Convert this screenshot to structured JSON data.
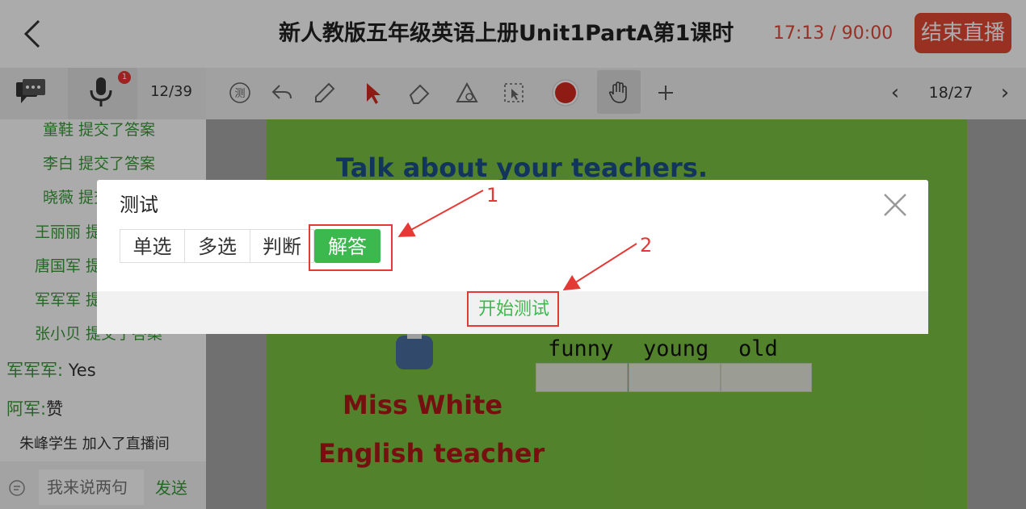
{
  "header": {
    "back_glyph": "〈",
    "title": "新人教版五年级英语上册Unit1PartA第1课时",
    "timer": "17:13 / 90:00",
    "end_button": "结束直播"
  },
  "toolbar": {
    "mic_badge": "1",
    "attendance": "12/39",
    "tool_icons": [
      "quiz-icon",
      "undo-icon",
      "pen-icon",
      "pointer-icon",
      "eraser-icon",
      "shapes-icon",
      "selection-icon",
      "color-dot-icon",
      "hand-icon",
      "plus-icon"
    ],
    "page_prev": "‹",
    "page_count": "18/27",
    "page_next": "›",
    "color": "#d62b1f"
  },
  "sidebar": {
    "messages": [
      {
        "text": "童鞋 提交了答案"
      },
      {
        "text": "李白 提交了答案"
      },
      {
        "text": "晓薇 提交了答案"
      },
      {
        "text": "王丽丽 提交了答案"
      },
      {
        "text": "唐国军 提交了答案"
      },
      {
        "text": "军军军 提交了答案"
      },
      {
        "text": "张小贝 提交了答案"
      }
    ],
    "chat_lines": [
      {
        "name": "军军军:",
        "text": " Yes"
      },
      {
        "name": "阿军:",
        "text": "赞"
      }
    ],
    "join_notice": "朱峰学生 加入了直播间",
    "input_placeholder": "我来说两句",
    "send_label": "发送"
  },
  "slide": {
    "title": "Talk about your teachers.",
    "words": [
      "funny",
      "young",
      "old"
    ],
    "name": "Miss White",
    "role": "English teacher"
  },
  "dialog": {
    "title": "测试",
    "tabs": [
      {
        "label": "单选"
      },
      {
        "label": "多选"
      },
      {
        "label": "判断"
      },
      {
        "label": "解答"
      }
    ],
    "active_tab": "解答",
    "start_button": "开始测试"
  },
  "annotations": {
    "label_1": "1",
    "label_2": "2",
    "color": "#e53935"
  }
}
